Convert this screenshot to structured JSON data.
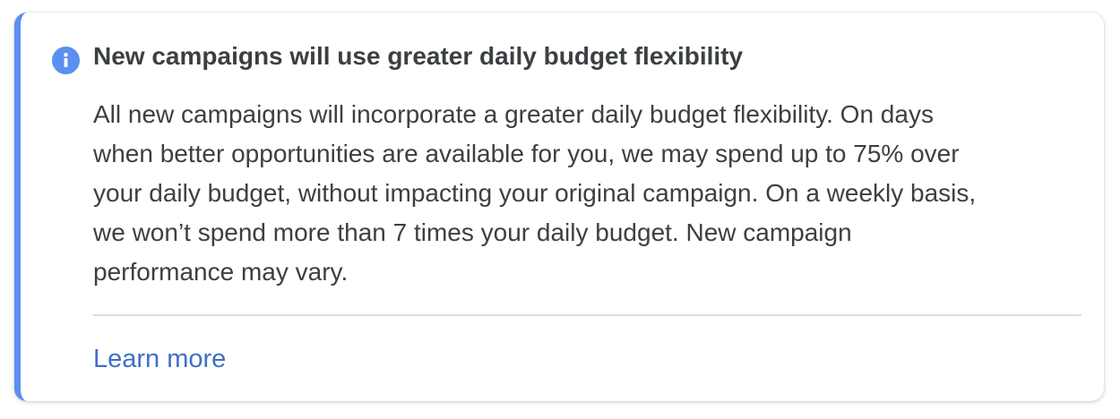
{
  "notice": {
    "icon": "info-icon",
    "title": "New campaigns will use greater daily budget flexibility",
    "body_lines": [
      "All new campaigns will incorporate a greater daily budget flexibility. On days",
      "when better opportunities are available for you, we may spend up to 75% over",
      "your daily budget, without impacting your original campaign. On a weekly basis,",
      "we won’t spend more than 7 times your daily budget. New campaign",
      "performance may vary."
    ],
    "learn_more_label": "Learn more",
    "colors": {
      "accent": "#5b8ff0",
      "link": "#3f6fc6",
      "text": "#3c4043",
      "divider": "#dadce0"
    }
  }
}
